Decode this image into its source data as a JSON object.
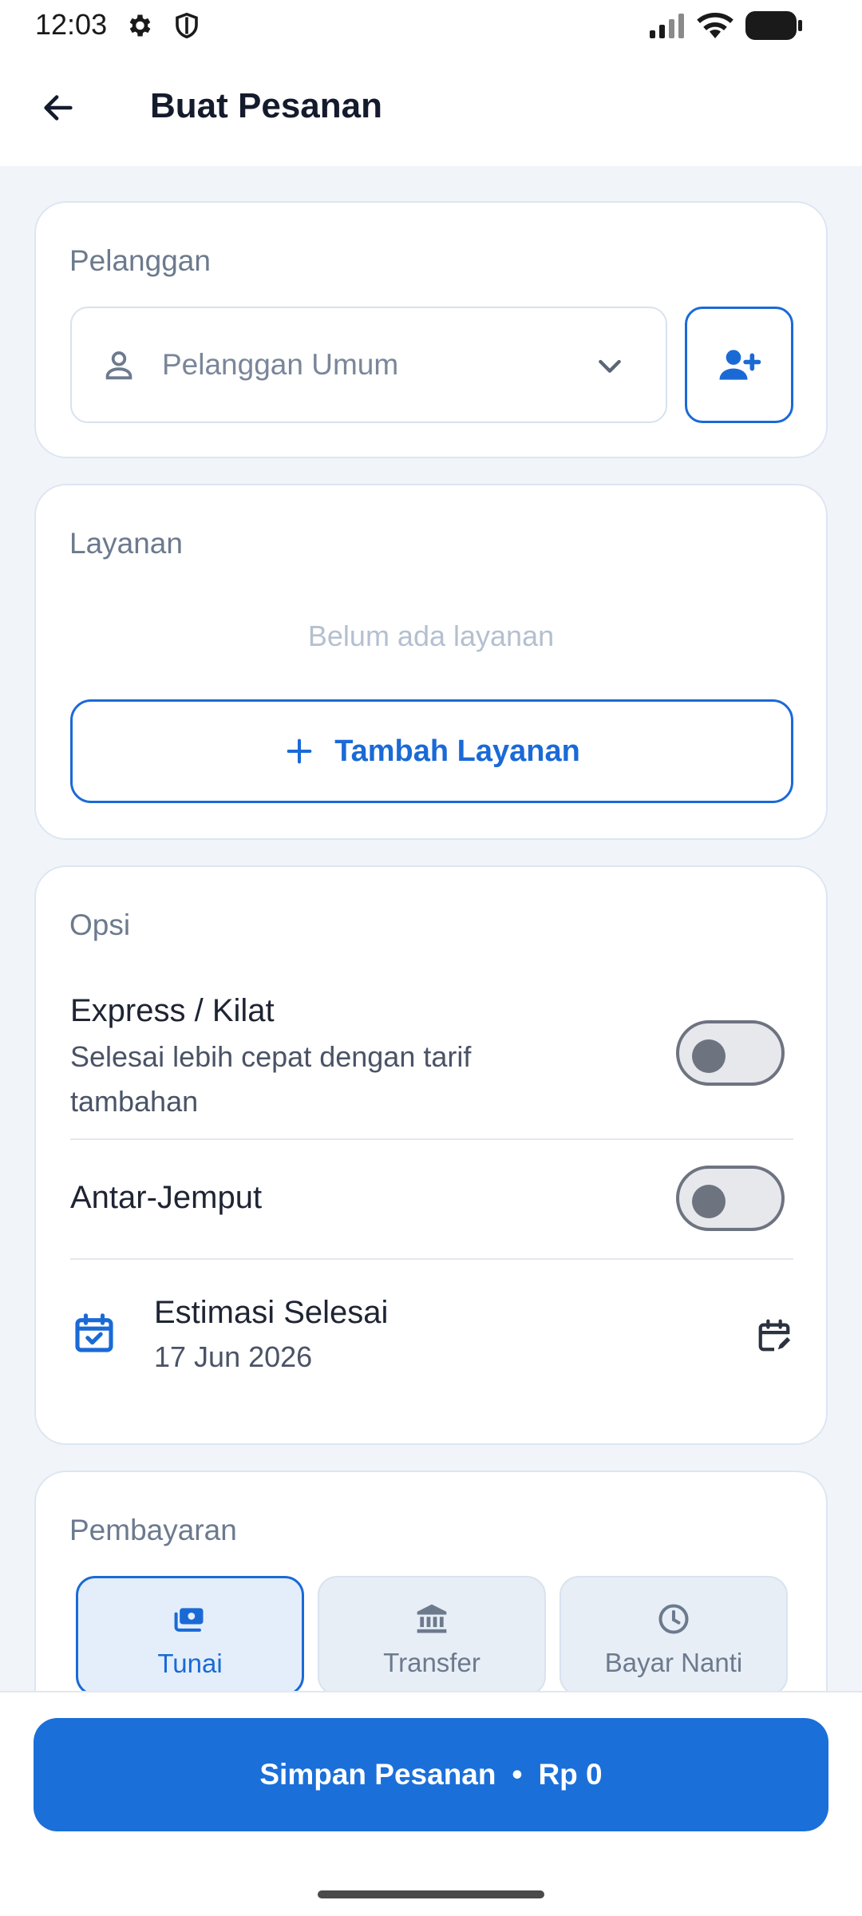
{
  "status_bar": {
    "time": "12:03"
  },
  "app_bar": {
    "title": "Buat Pesanan"
  },
  "customer": {
    "label": "Pelanggan",
    "selected": "Pelanggan Umum"
  },
  "services": {
    "label": "Layanan",
    "empty_text": "Belum ada layanan",
    "add_button": "Tambah Layanan"
  },
  "options": {
    "label": "Opsi",
    "express": {
      "title": "Express / Kilat",
      "subtitle": "Selesai lebih cepat dengan tarif tambahan",
      "enabled": false
    },
    "pickup": {
      "title": "Antar-Jemput",
      "enabled": false
    },
    "estimate": {
      "title": "Estimasi Selesai",
      "date": "17 Jun 2026"
    }
  },
  "payment": {
    "label": "Pembayaran",
    "methods": [
      {
        "label": "Tunai",
        "icon": "cash-icon",
        "selected": true
      },
      {
        "label": "Transfer",
        "icon": "bank-icon",
        "selected": false
      },
      {
        "label": "Bayar Nanti",
        "icon": "clock-icon",
        "selected": false
      }
    ]
  },
  "footer": {
    "save_label": "Simpan Pesanan",
    "separator": "•",
    "total": "Rp 0"
  },
  "colors": {
    "primary": "#1b6fd9",
    "background": "#f1f5fa",
    "muted": "#6c7a8e"
  }
}
